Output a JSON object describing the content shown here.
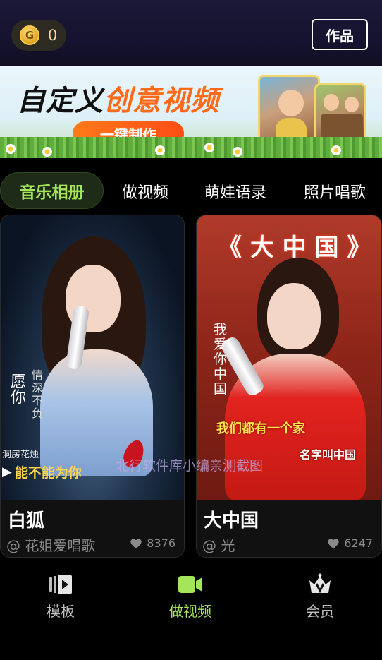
{
  "header": {
    "coin_symbol": "G",
    "coin_count": "0",
    "works_label": "作品"
  },
  "banner": {
    "title_part1": "自定义",
    "title_part2": "创意视频",
    "cta_label": "一键制作"
  },
  "tabs": [
    {
      "label": "音乐相册",
      "active": true
    },
    {
      "label": "做视频",
      "active": false
    },
    {
      "label": "萌娃语录",
      "active": false
    },
    {
      "label": "照片唱歌",
      "active": false
    }
  ],
  "cards": [
    {
      "title": "白狐",
      "author": "@ 花姐爱唱歌",
      "likes": "8376",
      "overlay": {
        "vertical_left": "愿你",
        "vertical_right": "情深不负",
        "tag": "洞房花烛",
        "caption": "能不能为你",
        "play_symbol": "▶"
      }
    },
    {
      "title": "大中国",
      "author": "@ 光",
      "likes": "6247",
      "overlay": {
        "headline": "《 大 中 国 》",
        "vertical_lyric": "我爱你中国",
        "line1": "我们都有一个家",
        "line2": "名字叫中国"
      }
    }
  ],
  "watermark": "北行软件库小编亲测截图",
  "bottom_nav": [
    {
      "label": "模板",
      "icon": "template-play-icon",
      "active": false
    },
    {
      "label": "做视频",
      "icon": "video-camera-icon",
      "active": true
    },
    {
      "label": "会员",
      "icon": "crown-v-icon",
      "active": false
    }
  ],
  "colors": {
    "accent_green": "#a4e55a",
    "banner_orange": "#ff6a1a",
    "coin_gold": "#f7c84a"
  }
}
